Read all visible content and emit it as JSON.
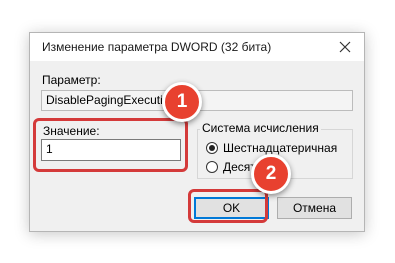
{
  "dialog": {
    "title": "Изменение параметра DWORD (32 бита)",
    "parameter_label": "Параметр:",
    "parameter_name": "DisablePagingExecutive",
    "value_label": "Значение:",
    "value": "1",
    "base_group_title": "Система исчисления",
    "radix_options": [
      {
        "label": "Шестнадцатеричная",
        "selected": true
      },
      {
        "label": "Десятичная",
        "selected": false
      }
    ],
    "ok_label": "OK",
    "cancel_label": "Отмена"
  },
  "annotations": {
    "step1": "1",
    "step2": "2",
    "highlight_color": "#d43a3a",
    "badge_color": "#e8412f"
  },
  "icons": {
    "close": "close-icon"
  }
}
